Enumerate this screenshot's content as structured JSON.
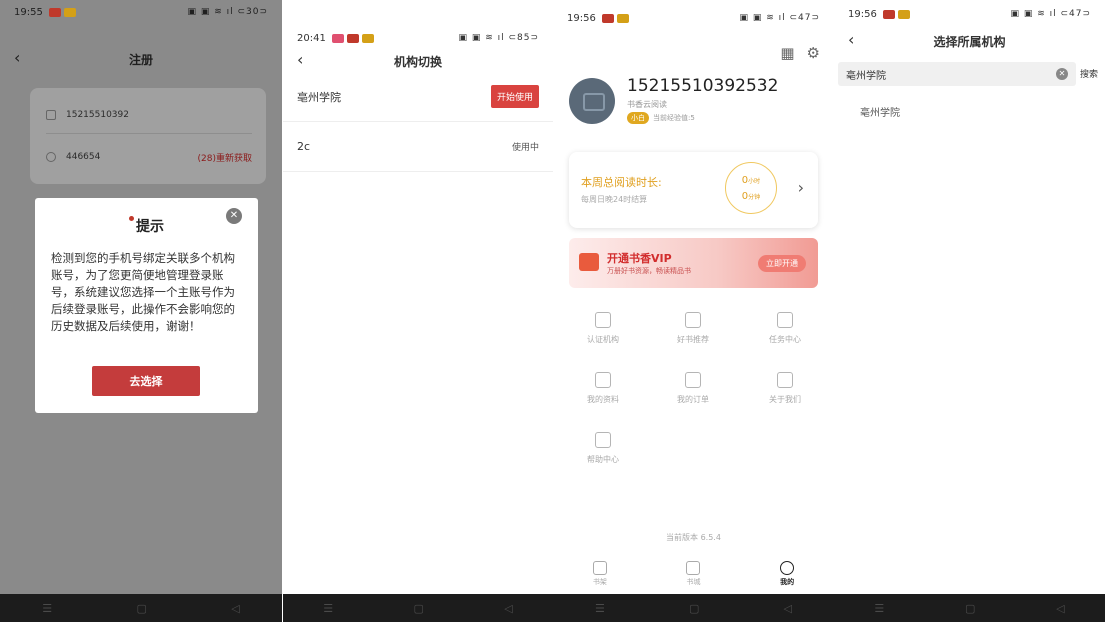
{
  "register": {
    "time": "19:55",
    "signal": "▣ ▣ ≋ ıl ⊂30⊃",
    "title": "注册",
    "phone": "15215510392",
    "code": "446654",
    "resend": "(28)重新获取",
    "dialog": {
      "title": "提示",
      "close": "✕",
      "message": "检测到您的手机号绑定关联多个机构账号，为了您更简便地管理登录账号，系统建议您选择一个主账号作为后续登录账号，此操作不会影响您的历史数据及后续使用，谢谢！",
      "button": "去选择"
    }
  },
  "switch_org": {
    "time": "20:41",
    "signal": "▣ ▣ ≋ ıl ⊂85⊃",
    "title": "机构切换",
    "orgs": [
      {
        "name": "亳州学院",
        "action": "开始使用"
      },
      {
        "name": "2c",
        "action": "使用中"
      }
    ]
  },
  "profile": {
    "time": "19:56",
    "signal": "▣ ▣ ≋ ıl ⊂47⊃",
    "username": "15215510392532",
    "app_name": "书香云阅读",
    "level_badge": "小白",
    "exp": "当前经验值:5",
    "reading": {
      "title": "本周总阅读时长:",
      "subtitle": "每周日晚24时结算",
      "hours": "0",
      "hours_unit": "小时",
      "minutes": "0",
      "minutes_unit": "分钟"
    },
    "vip": {
      "title": "开通书香VIP",
      "subtitle": "万册好书资源，畅读精品书",
      "button": "立即开通"
    },
    "menu": [
      "认证机构",
      "好书推荐",
      "任务中心",
      "我的资料",
      "我的订单",
      "关于我们",
      "帮助中心"
    ],
    "version": "当前版本 6.5.4",
    "tabs": [
      "书架",
      "书城",
      "我的"
    ]
  },
  "select_org": {
    "time": "19:56",
    "signal": "▣ ▣ ≋ ıl ⊂47⊃",
    "title": "选择所属机构",
    "search_value": "亳州学院",
    "search_button": "搜索",
    "result": "亳州学院"
  },
  "sysnav": {
    "menu": "☰",
    "home": "▢",
    "back": "◁"
  },
  "colors": {
    "accent_red": "#c43c3c",
    "gold": "#e0a020"
  }
}
